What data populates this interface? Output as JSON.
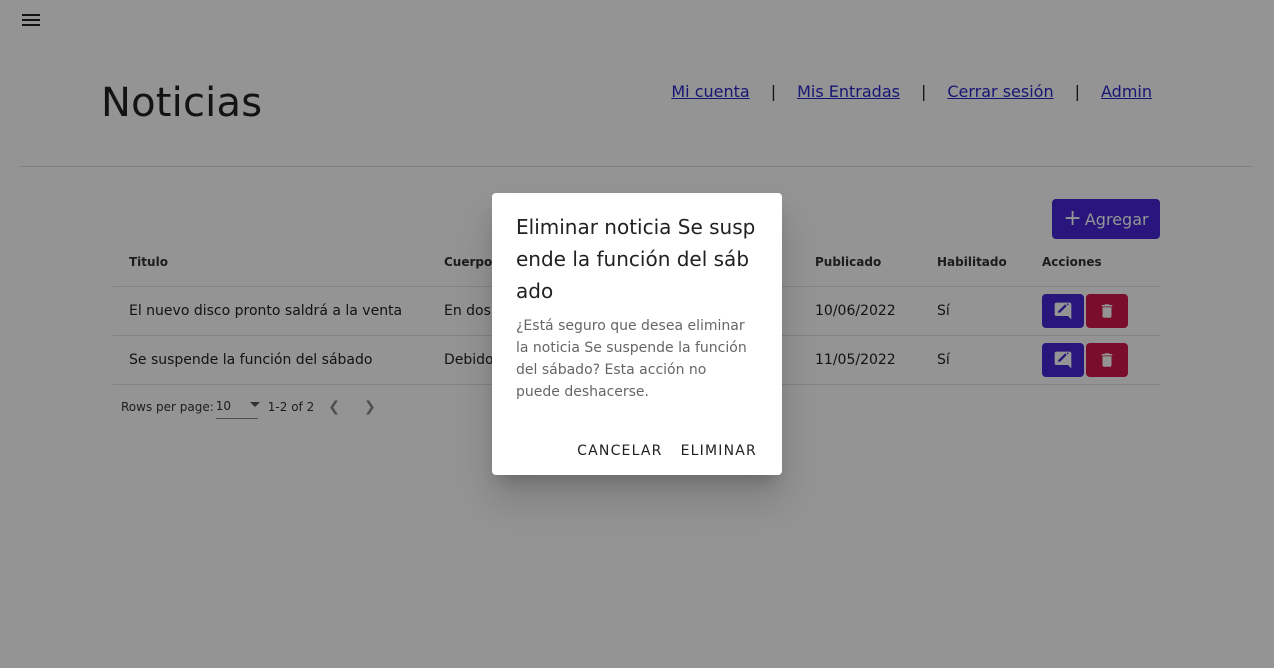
{
  "header": {
    "title": "Noticias",
    "nav": [
      "Mi cuenta",
      "Mis Entradas",
      "Cerrar sesión",
      "Admin"
    ],
    "separator": "|"
  },
  "toolbar": {
    "add_label": "Agregar",
    "add_icon": "plus-icon"
  },
  "table": {
    "columns": [
      "Titulo",
      "Cuerpo",
      "Publicado",
      "Habilitado",
      "Acciones"
    ],
    "rows": [
      {
        "titulo": "El nuevo disco pronto saldrá a la venta",
        "cuerpo": "En dos s",
        "publicado": "10/06/2022",
        "habilitado": "Sí"
      },
      {
        "titulo": "Se suspende la función del sábado",
        "cuerpo": "Debido",
        "publicado": "11/05/2022",
        "habilitado": "Sí"
      }
    ]
  },
  "pagination": {
    "rows_per_page_label": "Rows per page:",
    "rows_per_page": "10",
    "range": "1-2 of 2"
  },
  "dialog": {
    "title": "Eliminar noticia Se suspende la función del sábado",
    "body": "¿Está seguro que desea eliminar la noticia Se suspende la función del sábado? Esta acción no puede deshacerse.",
    "cancel": "CANCELAR",
    "confirm": "ELIMINAR"
  },
  "colors": {
    "primary": "#4527d6",
    "danger": "#d0184a",
    "link": "#2a27c8"
  }
}
